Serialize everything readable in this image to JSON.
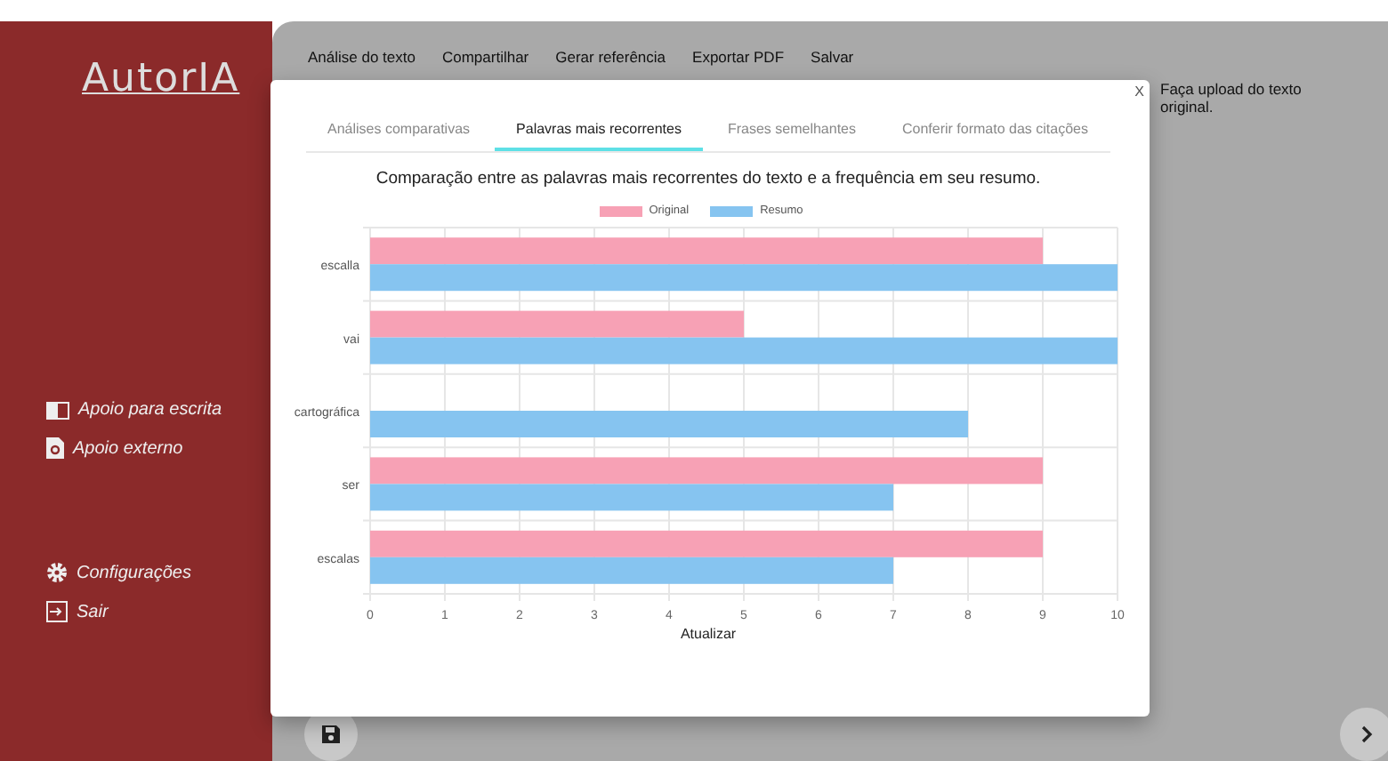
{
  "sidebar": {
    "logo": "AutorIA",
    "items": [
      {
        "label": "Apoio para escrita"
      },
      {
        "label": "Apoio externo"
      }
    ],
    "bottom_items": [
      {
        "label": "Configurações"
      },
      {
        "label": "Sair"
      }
    ]
  },
  "top_menu": [
    "Análise do texto",
    "Compartilhar",
    "Gerar referência",
    "Exportar PDF",
    "Salvar"
  ],
  "side_note": "Faça upload do texto original.",
  "modal": {
    "close": "X",
    "tabs": [
      {
        "label": "Análises comparativas",
        "selected": false
      },
      {
        "label": "Palavras mais recorrentes",
        "selected": true
      },
      {
        "label": "Frases semelhantes",
        "selected": false
      },
      {
        "label": "Conferir formato das citações",
        "selected": false
      }
    ],
    "chart_title": "Comparação entre as palavras mais recorrentes do texto e a frequência em seu resumo.",
    "chart_data": {
      "type": "bar",
      "orientation": "horizontal",
      "categories": [
        "escalla",
        "vai",
        "cartográfica",
        "ser",
        "escalas"
      ],
      "series": [
        {
          "name": "Original",
          "color": "#f7a1b5",
          "values": [
            9,
            5,
            null,
            9,
            9
          ]
        },
        {
          "name": "Resumo",
          "color": "#86c4f0",
          "values": [
            10,
            10,
            8,
            7,
            7
          ]
        }
      ],
      "xlim": [
        0,
        10
      ],
      "grid": true,
      "xticks": [
        0,
        1,
        2,
        3,
        4,
        5,
        6,
        7,
        8,
        9,
        10
      ]
    },
    "button": "Atualizar"
  }
}
